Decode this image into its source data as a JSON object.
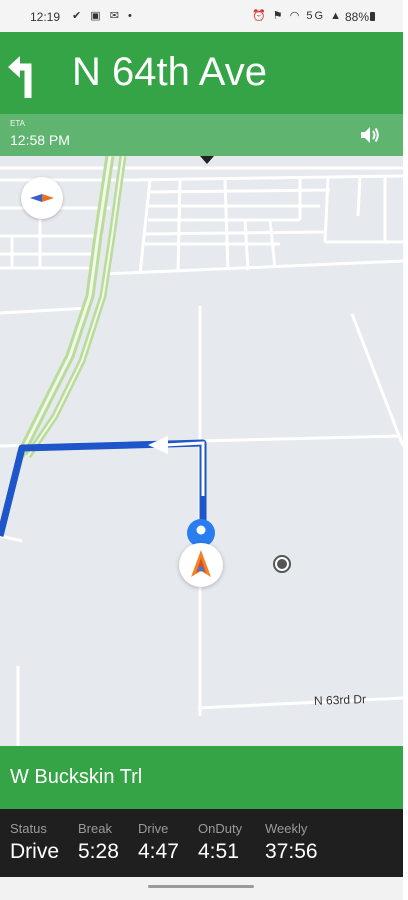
{
  "status_bar": {
    "time": "12:19",
    "battery": "88%",
    "network": "5G"
  },
  "header": {
    "turn_icon": "turn-left-arrow-icon",
    "street": "N 64th Ave"
  },
  "eta": {
    "label": "ETA",
    "time": "12:58 PM",
    "sound_icon": "speaker-icon"
  },
  "map": {
    "compass_icon": "compass-icon",
    "road_label": "N 63rd Dr",
    "route_color": "#1e55c8",
    "highway_color": "#b9dc9a",
    "vehicle_icon": "vehicle-arrow-icon",
    "location_icon": "current-location-icon",
    "poi_icon": "poi-dot-icon"
  },
  "next_street": {
    "name": "W Buckskin Trl"
  },
  "hos": {
    "items": [
      {
        "label": "Status",
        "value": "Drive"
      },
      {
        "label": "Break",
        "value": "5:28"
      },
      {
        "label": "Drive",
        "value": "4:47"
      },
      {
        "label": "OnDuty",
        "value": "4:51"
      },
      {
        "label": "Weekly",
        "value": "37:56"
      }
    ]
  },
  "colors": {
    "header_green": "#34a446",
    "eta_green": "#5fb46f",
    "hos_background": "#1f1f1f",
    "map_background": "#e6e9ee"
  }
}
